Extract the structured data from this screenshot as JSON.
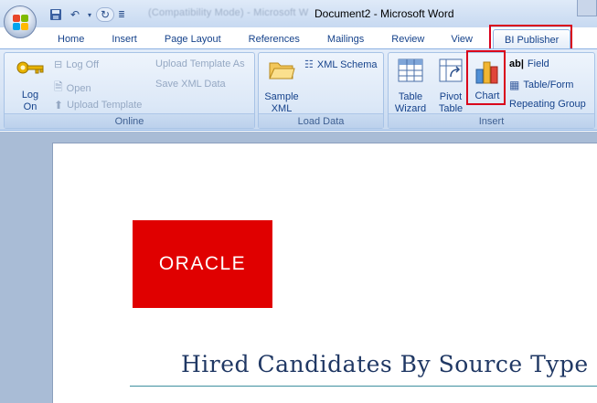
{
  "titlebar": {
    "faded_title": "(Compatibility Mode) - Microsoft W",
    "document_title": "Document2 - Microsoft Word"
  },
  "tabs": [
    "Home",
    "Insert",
    "Page Layout",
    "References",
    "Mailings",
    "Review",
    "View",
    "BI Publisher"
  ],
  "active_tab": "BI Publisher",
  "ribbon": {
    "online": {
      "caption": "Online",
      "log_on": [
        "Log",
        "On"
      ],
      "log_off": "Log Off",
      "open": "Open",
      "upload_template": "Upload Template",
      "upload_template_as": "Upload Template As",
      "save_xml_data": "Save XML Data"
    },
    "load_data": {
      "caption": "Load Data",
      "sample_xml": [
        "Sample",
        "XML"
      ],
      "xml_schema": "XML Schema"
    },
    "insert": {
      "caption": "Insert",
      "table_wizard": [
        "Table",
        "Wizard"
      ],
      "pivot_table": [
        "Pivot",
        "Table"
      ],
      "chart": "Chart",
      "field": "Field",
      "table_form": "Table/Form",
      "repeating_group": "Repeating Group"
    }
  },
  "document": {
    "logo_text": "ORACLE",
    "heading": "Hired Candidates By Source Type"
  },
  "colors": {
    "highlight": "#d9001b",
    "oracle_red": "#e00000",
    "ribbon_text": "#15428b"
  }
}
